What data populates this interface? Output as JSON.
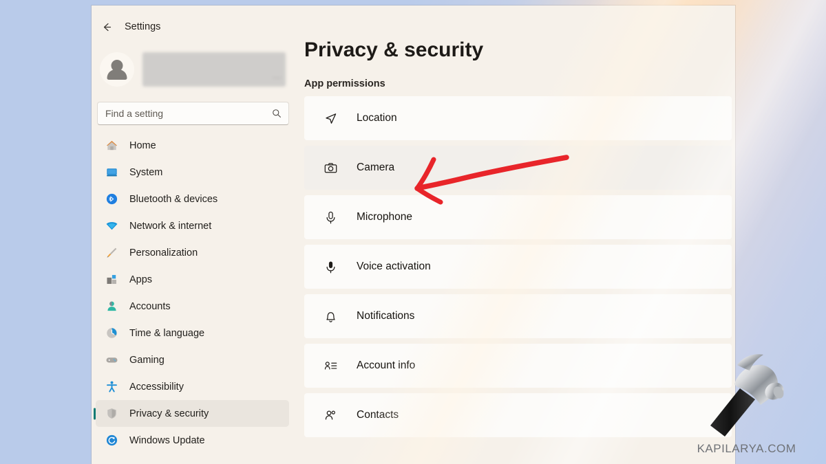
{
  "window": {
    "back_label": "back-arrow",
    "app_title": "Settings"
  },
  "account": {
    "redacted": true,
    "ellipsis": "..."
  },
  "search": {
    "placeholder": "Find a setting",
    "value": "",
    "icon": "search-icon"
  },
  "sidebar": {
    "items": [
      {
        "label": "Home",
        "icon": "home-icon",
        "selected": false
      },
      {
        "label": "System",
        "icon": "system-icon",
        "selected": false
      },
      {
        "label": "Bluetooth & devices",
        "icon": "bluetooth-icon",
        "selected": false
      },
      {
        "label": "Network & internet",
        "icon": "wifi-icon",
        "selected": false
      },
      {
        "label": "Personalization",
        "icon": "brush-icon",
        "selected": false
      },
      {
        "label": "Apps",
        "icon": "apps-icon",
        "selected": false
      },
      {
        "label": "Accounts",
        "icon": "account-icon",
        "selected": false
      },
      {
        "label": "Time & language",
        "icon": "clock-globe-icon",
        "selected": false
      },
      {
        "label": "Gaming",
        "icon": "gamepad-icon",
        "selected": false
      },
      {
        "label": "Accessibility",
        "icon": "accessibility-icon",
        "selected": false
      },
      {
        "label": "Privacy & security",
        "icon": "shield-icon",
        "selected": true
      },
      {
        "label": "Windows Update",
        "icon": "update-icon",
        "selected": false
      }
    ]
  },
  "main": {
    "page_title": "Privacy & security",
    "section_title": "App permissions",
    "permissions": [
      {
        "label": "Location",
        "icon": "location-arrow-icon",
        "highlighted": false
      },
      {
        "label": "Camera",
        "icon": "camera-icon",
        "highlighted": true
      },
      {
        "label": "Microphone",
        "icon": "microphone-icon",
        "highlighted": false
      },
      {
        "label": "Voice activation",
        "icon": "voice-mic-icon",
        "highlighted": false
      },
      {
        "label": "Notifications",
        "icon": "bell-icon",
        "highlighted": false
      },
      {
        "label": "Account info",
        "icon": "account-info-icon",
        "highlighted": false
      },
      {
        "label": "Contacts",
        "icon": "contacts-icon",
        "highlighted": false
      }
    ]
  },
  "annotation": {
    "type": "arrow",
    "color": "#e8252a",
    "points_to": "Camera"
  },
  "watermark": {
    "text": "KAPILARYA.COM",
    "icon": "hammer-icon"
  },
  "colors": {
    "accent": "#0f7b74",
    "annotation": "#e8252a",
    "window_bg": "#f6f1ea",
    "card_bg": "#fcfbf9"
  }
}
